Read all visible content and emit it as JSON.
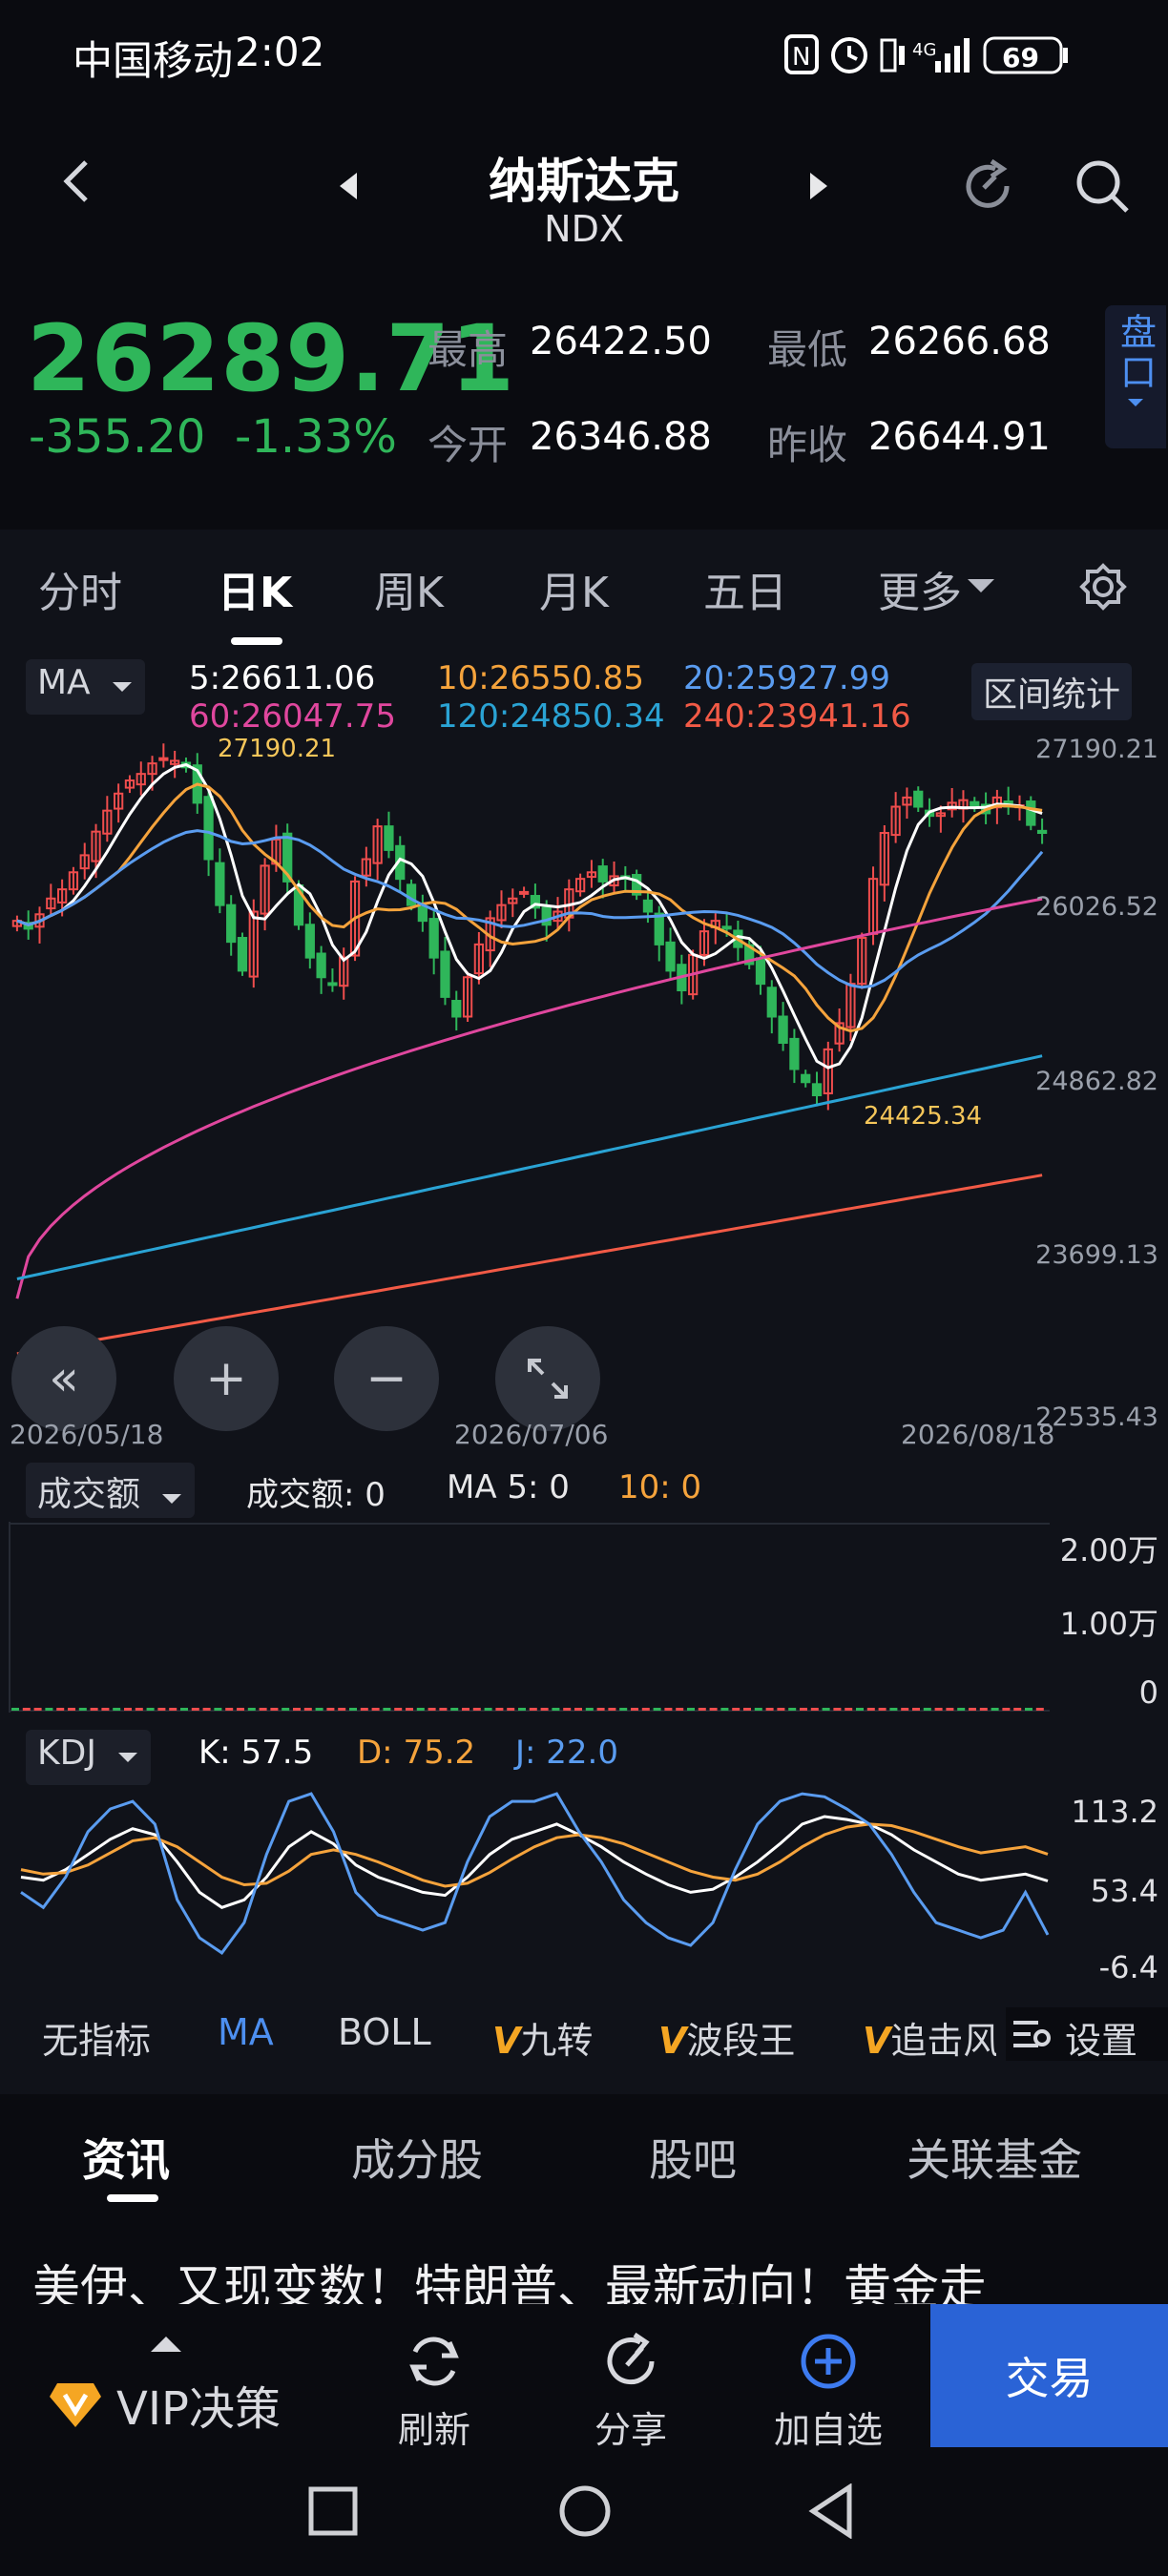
{
  "status_bar": {
    "carrier": "中国移动",
    "time": "2:02",
    "network": "4G",
    "battery": "69"
  },
  "nav": {
    "title": "纳斯达克",
    "symbol": "NDX"
  },
  "quote": {
    "price": "26289.71",
    "change": "-355.20",
    "change_pct": "-1.33%",
    "high_label": "最高",
    "high": "26422.50",
    "low_label": "最低",
    "low": "26266.68",
    "open_label": "今开",
    "open": "26346.88",
    "prev_close_label": "昨收",
    "prev_close": "26644.91",
    "panel_btn": "盘口"
  },
  "period_tabs": [
    "分时",
    "日K",
    "周K",
    "月K",
    "五日",
    "更多"
  ],
  "active_tab": "日K",
  "ma_bar": {
    "selector": "MA",
    "ma5": "5:26611.06",
    "ma10": "10:26550.85",
    "ma20": "20:25927.99",
    "ma60": "60:26047.75",
    "ma120": "120:24850.34",
    "ma240": "240:23941.16",
    "range_btn": "区间统计"
  },
  "colors": {
    "ma5": "#ffffff",
    "ma10": "#f5a33c",
    "ma20": "#5a9cf0",
    "ma60": "#e0479e",
    "ma120": "#2aa3d4",
    "ma240": "#f25a46",
    "up": "#ef4d4d",
    "down": "#2fb65a",
    "k": "#ffffff",
    "d": "#f5a33c",
    "j": "#5a9cf0"
  },
  "chart_data": [
    {
      "type": "candlestick",
      "y_axis_ticks": [
        "27190.21",
        "26026.52",
        "24862.82",
        "23699.13",
        "22535.43"
      ],
      "ylim": [
        22535.43,
        27190.21
      ],
      "x_axis_ticks": [
        "2026/05/18",
        "2026/07/06",
        "2026/08/18"
      ],
      "annotations": {
        "max": "27190.21",
        "min": "24425.34"
      },
      "close": [
        25880,
        25820,
        25930,
        26050,
        26120,
        26250,
        26380,
        26560,
        26720,
        26850,
        26950,
        27000,
        27080,
        27120,
        27100,
        27050,
        26780,
        26350,
        26000,
        25720,
        25500,
        25950,
        26300,
        26500,
        26180,
        25850,
        25600,
        25450,
        25400,
        25600,
        26180,
        26350,
        26600,
        26420,
        26200,
        26000,
        25880,
        25600,
        25300,
        25150,
        25450,
        25700,
        25900,
        26000,
        26050,
        26100,
        25980,
        25850,
        25950,
        26120,
        26200,
        26250,
        26180,
        26220,
        26200,
        26080,
        25950,
        25700,
        25500,
        25350,
        25620,
        25800,
        25880,
        25820,
        25680,
        25550,
        25400,
        25150,
        24950,
        24750,
        24650,
        24550,
        24900,
        25100,
        25400,
        25750,
        26200,
        26550,
        26750,
        26820,
        26750,
        26680,
        26700,
        26780,
        26800,
        26750,
        26700,
        26820,
        26750,
        26760,
        26611,
        26550
      ],
      "ma5_last": 26611.06,
      "ma10_last": 26550.85,
      "ma20_last": 25927.99,
      "ma60_last": 26047.75,
      "ma120_last": 24850.34,
      "ma240_last": 23941.16
    },
    {
      "type": "bar",
      "title": "成交额",
      "y_axis_ticks": [
        "2.00万",
        "1.00万",
        "0"
      ],
      "ylim": [
        0,
        20000
      ],
      "values_label": "成交额: 0",
      "ma5_label": "MA 5: 0",
      "ma10_label": "10: 0"
    },
    {
      "type": "line",
      "title": "KDJ",
      "y_axis_ticks": [
        "113.2",
        "53.4",
        "-6.4"
      ],
      "ylim": [
        -6.4,
        113.2
      ],
      "k_label": "K: 57.5",
      "d_label": "D: 75.2",
      "j_label": "J: 22.0",
      "series": [
        {
          "name": "K",
          "values": [
            60,
            58,
            65,
            75,
            85,
            92,
            88,
            70,
            50,
            40,
            45,
            60,
            80,
            90,
            82,
            68,
            60,
            55,
            50,
            48,
            60,
            75,
            85,
            90,
            95,
            88,
            80,
            70,
            62,
            55,
            50,
            52,
            60,
            70,
            82,
            95,
            100,
            98,
            95,
            88,
            78,
            70,
            62,
            58,
            60,
            62,
            57.5
          ]
        },
        {
          "name": "D",
          "values": [
            65,
            62,
            63,
            68,
            76,
            84,
            86,
            80,
            70,
            60,
            55,
            56,
            64,
            75,
            78,
            75,
            70,
            64,
            58,
            54,
            56,
            63,
            72,
            80,
            86,
            88,
            86,
            82,
            76,
            70,
            64,
            60,
            58,
            62,
            70,
            80,
            88,
            93,
            95,
            94,
            90,
            85,
            80,
            76,
            78,
            80,
            75.2
          ]
        },
        {
          "name": "J",
          "values": [
            50,
            40,
            60,
            90,
            105,
            110,
            95,
            45,
            20,
            10,
            30,
            75,
            110,
            115,
            90,
            50,
            35,
            30,
            25,
            30,
            70,
            100,
            110,
            110,
            115,
            90,
            70,
            45,
            30,
            20,
            15,
            30,
            65,
            95,
            110,
            115,
            113,
            105,
            95,
            75,
            50,
            30,
            25,
            20,
            25,
            50,
            22.0
          ]
        }
      ]
    }
  ],
  "volume_selector": "成交额",
  "kdj_selector": "KDJ",
  "indicator_tabs": [
    "无指标",
    "MA",
    "BOLL",
    "九转",
    "波段王",
    "追击风"
  ],
  "indicator_settings": "设置",
  "info_tabs": [
    "资讯",
    "成分股",
    "股吧",
    "关联基金"
  ],
  "news_headline": "美伊、又现变数！特朗普、最新动向！黄金走",
  "bottom_bar": {
    "vip": "VIP决策",
    "refresh": "刷新",
    "share": "分享",
    "add": "加自选",
    "trade": "交易"
  }
}
